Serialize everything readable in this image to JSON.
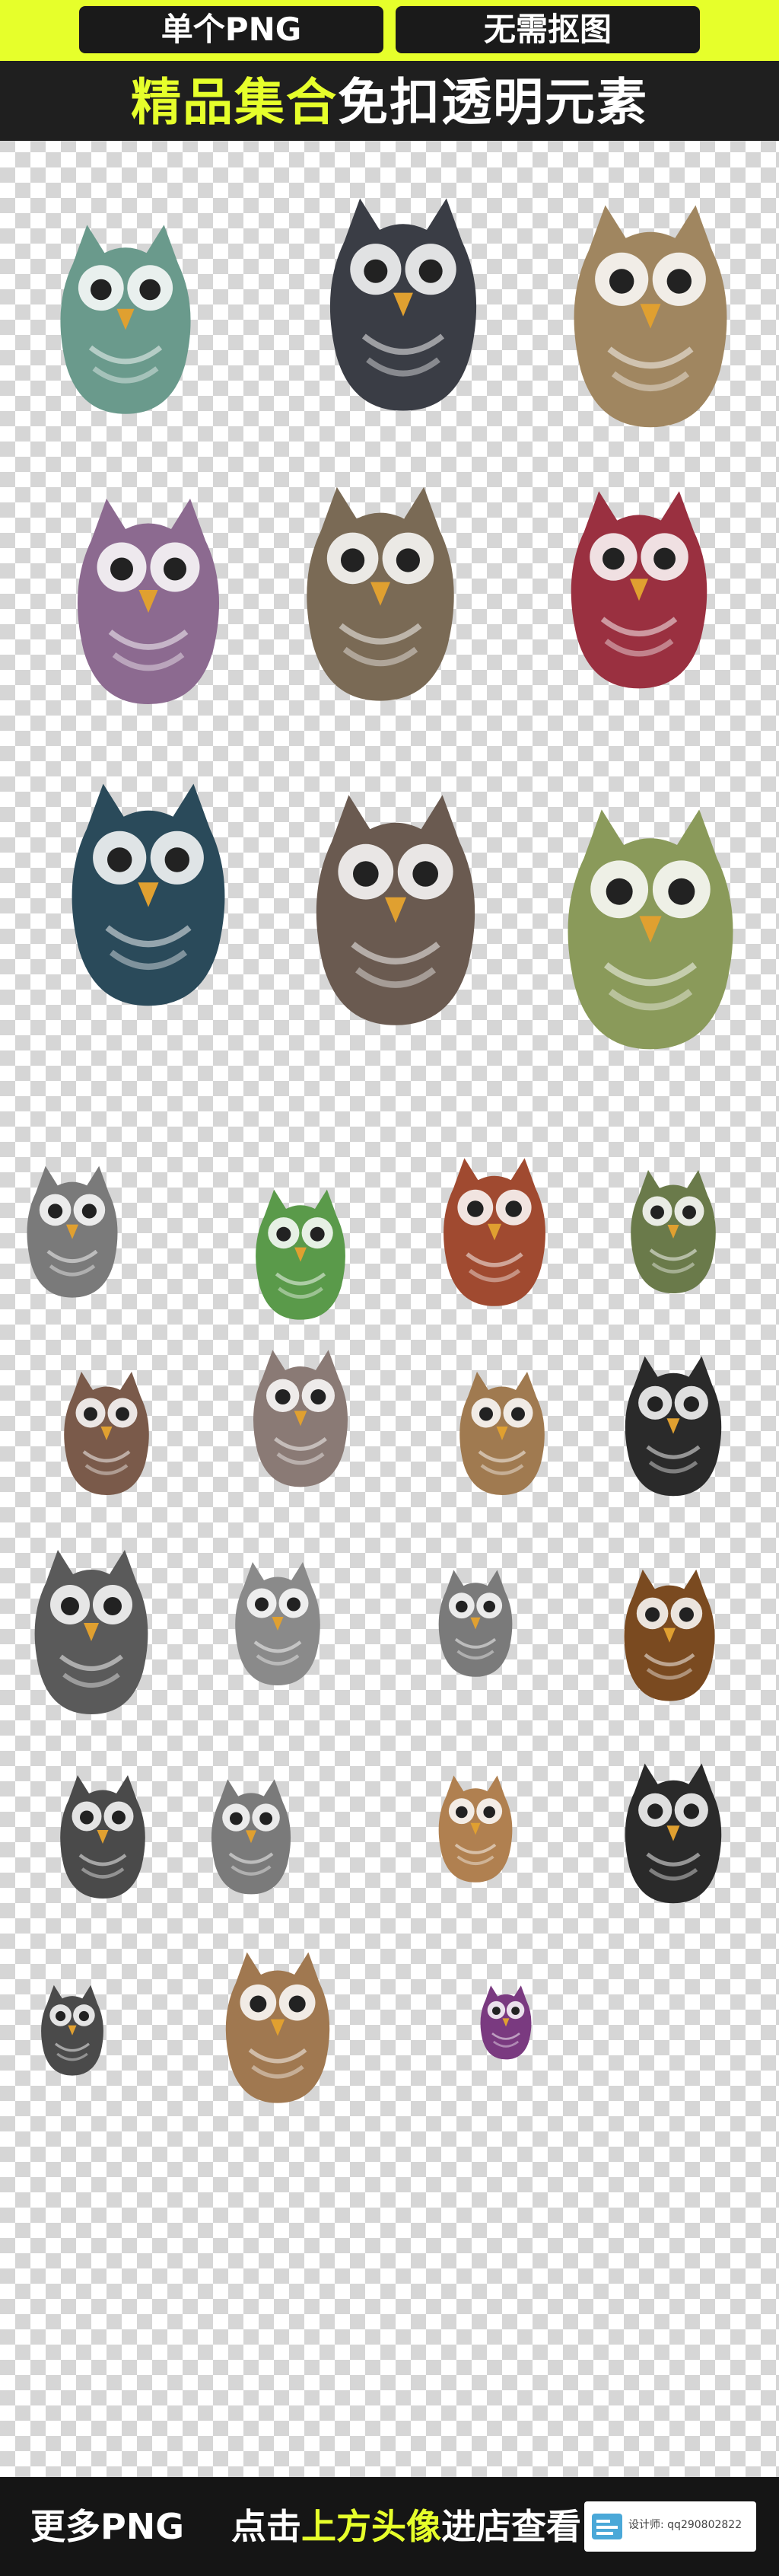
{
  "header": {
    "tag_left": "单个PNG",
    "tag_right": "无需抠图",
    "headline_accent": "精品集合",
    "headline_rest": "免扣透明元素"
  },
  "footer": {
    "text_prefix": "更多PNG",
    "text_mid": "点击",
    "text_highlight": "上方头像",
    "text_suffix": "进店查看",
    "designer_label": "设计师: qq290802822"
  },
  "colors": {
    "accent": "#e6ff2b",
    "header_bg": "#1f1f1f",
    "footer_bg": "#151515"
  },
  "illustrations": [
    "owl-teal-scarf",
    "owl-gray-sketch",
    "owl-watercolor-brown",
    "owl-purple-tree",
    "owl-realistic-fluffy",
    "owl-egg-pattern",
    "owl-watercolor-dark",
    "owl-on-branching-tree",
    "owl-green-cartoon",
    "owl-flower-crown",
    "owl-green-leaves",
    "owl-ornate-colorful",
    "owl-green-tattoo",
    "owl-scarf-book",
    "owl-fat-gray",
    "owl-brown-nest",
    "owl-black-tribal",
    "owl-pencil-sketch",
    "owl-headphones",
    "owl-necktie",
    "owl-autumn-foliage",
    "owl-on-stump",
    "owl-pink-bow",
    "owl-barn-watercolor",
    "owl-ink-wreath",
    "owl-blue-eyes-line",
    "owl-graduate",
    "owl-small-colorful"
  ]
}
